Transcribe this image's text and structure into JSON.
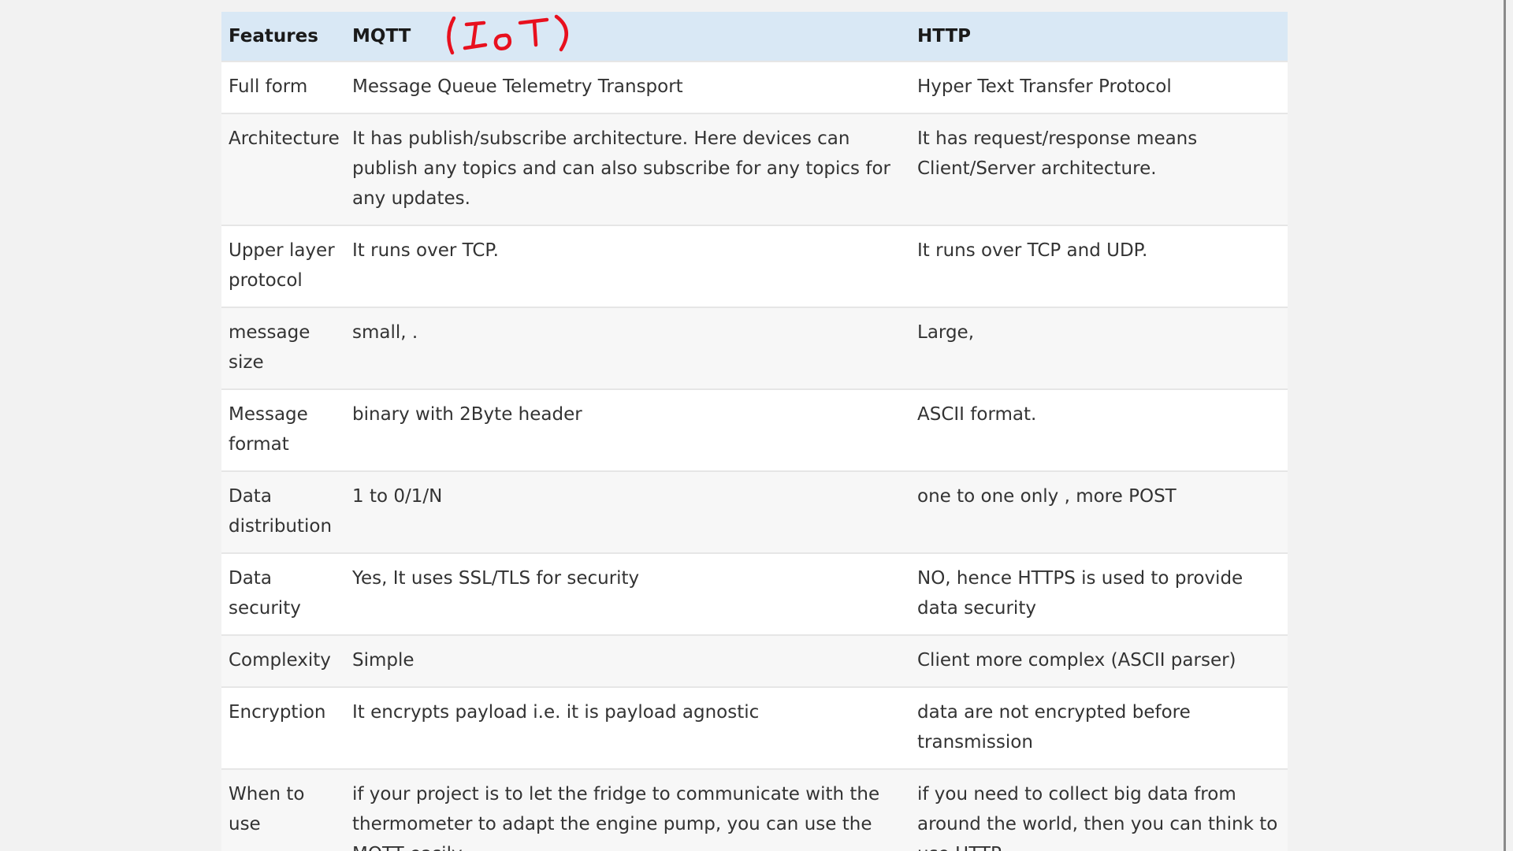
{
  "table": {
    "headers": [
      "Features",
      "MQTT",
      "HTTP"
    ],
    "rows": [
      {
        "feature": "Full form",
        "mqtt": "Message Queue Telemetry Transport",
        "http": "Hyper Text Transfer Protocol"
      },
      {
        "feature": "Architecture",
        "mqtt": "It has publish/subscribe architecture. Here devices can publish any topics and can also subscribe for any topics for any updates.",
        "http": "It has request/response means Client/Server architecture."
      },
      {
        "feature": "Upper layer protocol",
        "mqtt": "It runs over TCP.",
        "http": "It runs over TCP and UDP."
      },
      {
        "feature": "message size",
        "mqtt": "small, .",
        "http": "Large,"
      },
      {
        "feature": "Message format",
        "mqtt": "binary with 2Byte header",
        "http": "ASCII format."
      },
      {
        "feature": "Data distribution",
        "mqtt": "1 to 0/1/N",
        "http": "one to one only , more POST"
      },
      {
        "feature": "Data security",
        "mqtt": "Yes, It uses SSL/TLS for security",
        "http": "NO, hence HTTPS is used to provide data security"
      },
      {
        "feature": "Complexity",
        "mqtt": "Simple",
        "http": "Client more complex (ASCII parser)"
      },
      {
        "feature": "Encryption",
        "mqtt": "It encrypts payload i.e. it is payload agnostic",
        "http": "data are not encrypted before transmission"
      },
      {
        "feature": "When to use",
        "mqtt": "if your project is to let the fridge to communicate with the thermometer to adapt the engine pump, you can use the MQTT easily",
        "http": "if you need to collect big data from around the world, then you can think to use HTTP"
      }
    ]
  },
  "annotation": {
    "text": "(IoT)",
    "color": "#e8101e"
  },
  "colors": {
    "header_bg": "#d9e8f5",
    "row_odd": "#ffffff",
    "row_even": "#f7f7f7"
  }
}
